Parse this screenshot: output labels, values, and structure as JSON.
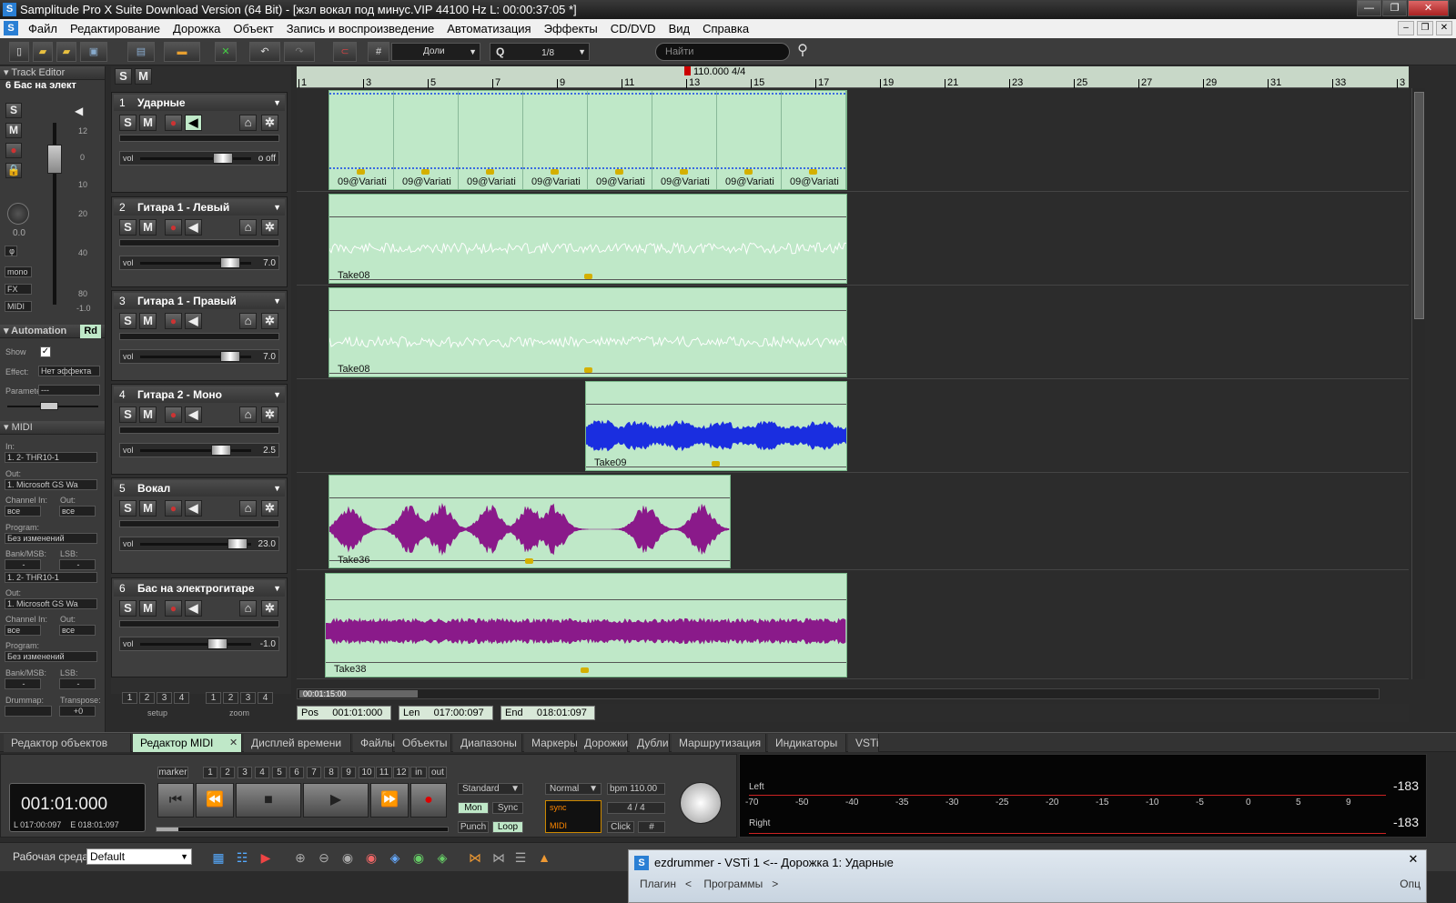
{
  "window": {
    "title": "Samplitude Pro X Suite Download Version (64 Bit) - [жзл вокал под минус.VIP   44100 Hz L: 00:00:37:05 *]",
    "btn_min": "—",
    "btn_max": "❐",
    "btn_close": "✕"
  },
  "menu": {
    "items": [
      "Файл",
      "Редактирование",
      "Дорожка",
      "Объект",
      "Запись и воспроизведение",
      "Автоматизация",
      "Эффекты",
      "CD/DVD",
      "Вид",
      "Справка"
    ]
  },
  "toolbar": {
    "grid_value": "Доли",
    "quantize_label": "Q",
    "quantize_value": "1/8",
    "search_placeholder": "Найти"
  },
  "ruler": {
    "tempo": "110.000 4/4",
    "bars": [
      "1",
      "3",
      "5",
      "7",
      "9",
      "11",
      "13",
      "15",
      "17",
      "19",
      "21",
      "23",
      "25",
      "27",
      "29",
      "31",
      "33",
      "3"
    ]
  },
  "left_panel": {
    "track_editor": "Track Editor",
    "track_select": "6  Бас на элект",
    "pan_value": "0.0",
    "fader_scale": [
      "12",
      "0",
      "10",
      "20",
      "40",
      "80",
      "-1.0"
    ],
    "mono": "mono",
    "fx": "FX",
    "midi_btn": "MIDI",
    "automation": "Automation",
    "rd": "Rd",
    "show": "Show",
    "effect": "Effect:",
    "effect_val": "Нет эффекта",
    "parameter": "Parameter",
    "param_val": "---",
    "midi": "MIDI",
    "in": "In:",
    "in_val": "1. 2- THR10-1",
    "out": "Out:",
    "out_val": "1. Microsoft GS Wa",
    "channel_in": "Channel In:",
    "out2": "Out:",
    "all": "все",
    "program": "Program:",
    "program_val": "Без изменений",
    "bankmsb": "Bank/MSB:",
    "lsb": "LSB:",
    "dash": "-",
    "in_val2": "1. 2- THR10-1",
    "out_val2": "1. Microsoft GS Wa",
    "drummap": "Drummap:",
    "transpose": "Transpose:",
    "transpose_val": "+0",
    "sm_s": "S",
    "sm_m": "M"
  },
  "tracks": [
    {
      "num": "1",
      "name": "Ударные",
      "vol": "o off",
      "vol_level": 0.8
    },
    {
      "num": "2",
      "name": "Гитара 1 - Левый",
      "vol": "7.0",
      "vol_level": 0.88
    },
    {
      "num": "3",
      "name": "Гитара 1 - Правый",
      "vol": "7.0",
      "vol_level": 0.88
    },
    {
      "num": "4",
      "name": "Гитара 2 - Моно",
      "vol": "2.5",
      "vol_level": 0.78
    },
    {
      "num": "5",
      "name": "Вокал",
      "vol": "23.0",
      "vol_level": 0.96
    },
    {
      "num": "6",
      "name": "Бас на электрогитаре",
      "vol": "-1.0",
      "vol_level": 0.74
    }
  ],
  "track_btns": {
    "s": "S",
    "m": "M",
    "vol": "vol"
  },
  "objects": {
    "drum_name": "09@Variati",
    "t2": "Take08",
    "t3": "Take08",
    "t4": "Take09",
    "t5": "Take36",
    "t6": "Take38"
  },
  "colors": {
    "object_bg": "#bfe8c8",
    "wave_guitar": "#ffffff",
    "wave_blue": "#1a2ee0",
    "wave_purple": "#8a1a8a"
  },
  "setup_zoom": {
    "nums": [
      "1",
      "2",
      "3",
      "4"
    ],
    "setup": "setup",
    "zoom": "zoom"
  },
  "position": {
    "scroll_time": "00:01:15:00",
    "pos_label": "Pos",
    "pos": "001:01:000",
    "len_label": "Len",
    "len": "017:00:097",
    "end_label": "End",
    "end": "018:01:097"
  },
  "tabs": [
    "Редактор объектов",
    "Редактор MIDI",
    "Дисплей времени",
    "Файлы",
    "Объекты",
    "Диапазоны",
    "Маркеры",
    "Дорожки",
    "Дубли",
    "Маршрутизация",
    "Индикаторы",
    "VSTi"
  ],
  "transport": {
    "time": "001:01:000",
    "l": "L  017:00:097",
    "e": "E   018:01:097",
    "marker": "marker",
    "in": "in",
    "out": "out",
    "standard": "Standard",
    "normal": "Normal",
    "bpm": "bpm 110.00",
    "sig": "4 / 4",
    "mon": "Mon",
    "sync": "Sync",
    "punch": "Punch",
    "loop": "Loop",
    "click": "Click",
    "marker_nums": [
      "1",
      "2",
      "3",
      "4",
      "5",
      "6",
      "7",
      "8",
      "9",
      "10",
      "11",
      "12"
    ]
  },
  "vu": {
    "left": "Left",
    "right": "Right",
    "db_l": "-183",
    "db_r": "-183",
    "scale": [
      "-70",
      "-50",
      "-40",
      "-35",
      "-30",
      "-25",
      "-20",
      "-15",
      "-10",
      "-5",
      "0",
      "5",
      "9"
    ]
  },
  "status": {
    "workspace_label": "Рабочая среда:",
    "workspace": "Default"
  },
  "vsti": {
    "title": "ezdrummer - VSTi 1    <-- Дорожка 1: Ударные",
    "menu1": "Плагин",
    "menu2": "Программы",
    "menu3": "Опц"
  }
}
